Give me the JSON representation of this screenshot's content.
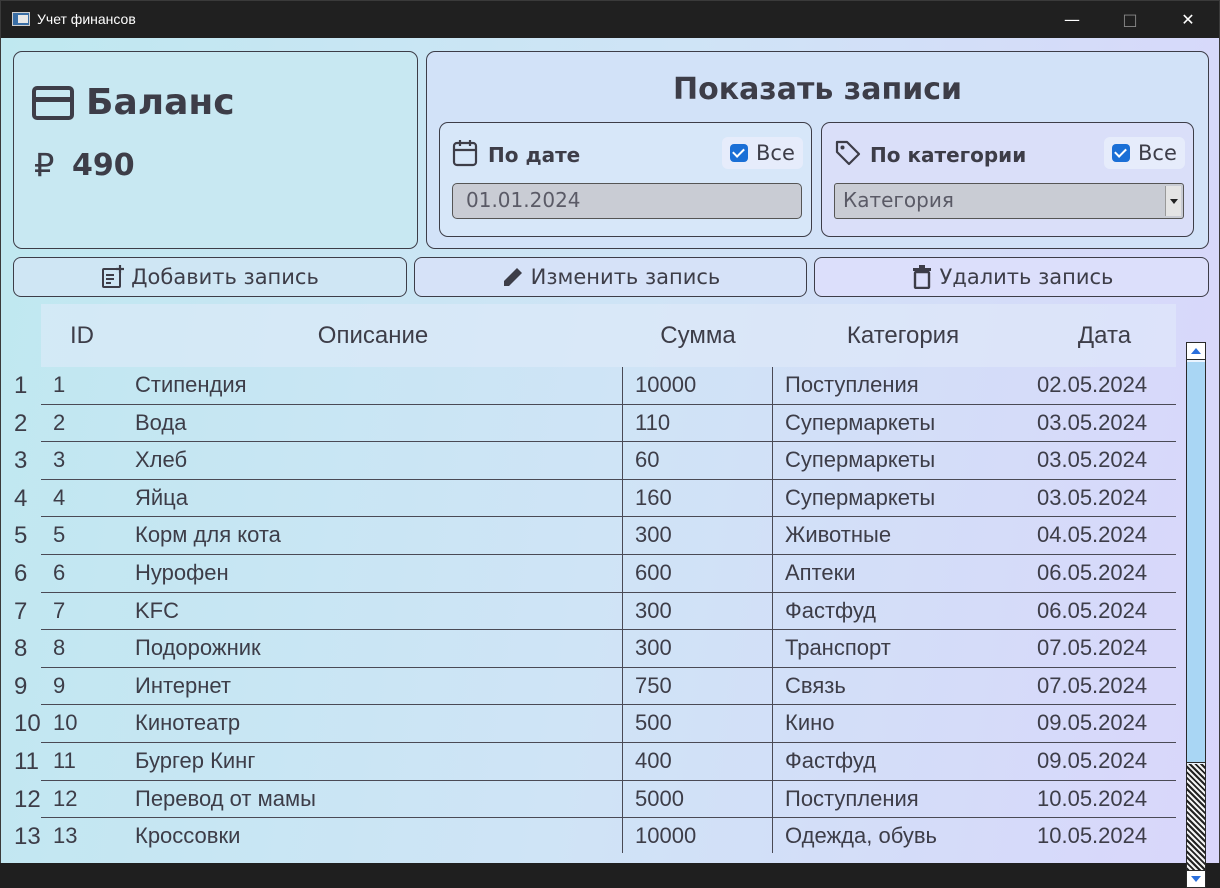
{
  "window": {
    "title": "Учет финансов"
  },
  "balance": {
    "title": "Баланс",
    "currency_symbol": "₽",
    "value": "490"
  },
  "filters": {
    "title": "Показать записи",
    "by_date": {
      "label": "По дате",
      "all_label": "Все",
      "all_checked": true,
      "date_value": "01.01.2024"
    },
    "by_category": {
      "label": "По категории",
      "all_label": "Все",
      "all_checked": true,
      "placeholder": "Категория"
    }
  },
  "actions": {
    "add": "Добавить запись",
    "edit": "Изменить запись",
    "delete": "Удалить запись"
  },
  "table": {
    "columns": [
      "ID",
      "Описание",
      "Сумма",
      "Категория",
      "Дата"
    ],
    "rows": [
      {
        "num": "1",
        "id": "1",
        "desc": "Стипендия",
        "sum": "10000",
        "cat": "Поступления",
        "date": "02.05.2024"
      },
      {
        "num": "2",
        "id": "2",
        "desc": "Вода",
        "sum": "110",
        "cat": "Супермаркеты",
        "date": "03.05.2024"
      },
      {
        "num": "3",
        "id": "3",
        "desc": "Хлеб",
        "sum": "60",
        "cat": "Супермаркеты",
        "date": "03.05.2024"
      },
      {
        "num": "4",
        "id": "4",
        "desc": "Яйца",
        "sum": "160",
        "cat": "Супермаркеты",
        "date": "03.05.2024"
      },
      {
        "num": "5",
        "id": "5",
        "desc": "Корм для кота",
        "sum": "300",
        "cat": "Животные",
        "date": "04.05.2024"
      },
      {
        "num": "6",
        "id": "6",
        "desc": "Нурофен",
        "sum": "600",
        "cat": "Аптеки",
        "date": "06.05.2024"
      },
      {
        "num": "7",
        "id": "7",
        "desc": "KFC",
        "sum": "300",
        "cat": "Фастфуд",
        "date": "06.05.2024"
      },
      {
        "num": "8",
        "id": "8",
        "desc": "Подорожник",
        "sum": "300",
        "cat": "Транспорт",
        "date": "07.05.2024"
      },
      {
        "num": "9",
        "id": "9",
        "desc": "Интернет",
        "sum": "750",
        "cat": "Связь",
        "date": "07.05.2024"
      },
      {
        "num": "10",
        "id": "10",
        "desc": "Кинотеатр",
        "sum": "500",
        "cat": "Кино",
        "date": "09.05.2024"
      },
      {
        "num": "11",
        "id": "11",
        "desc": "Бургер Кинг",
        "sum": "400",
        "cat": "Фастфуд",
        "date": "09.05.2024"
      },
      {
        "num": "12",
        "id": "12",
        "desc": "Перевод от мамы",
        "sum": "5000",
        "cat": "Поступления",
        "date": "10.05.2024"
      },
      {
        "num": "13",
        "id": "13",
        "desc": "Кроссовки",
        "sum": "10000",
        "cat": "Одежда, обувь",
        "date": "10.05.2024"
      }
    ]
  }
}
